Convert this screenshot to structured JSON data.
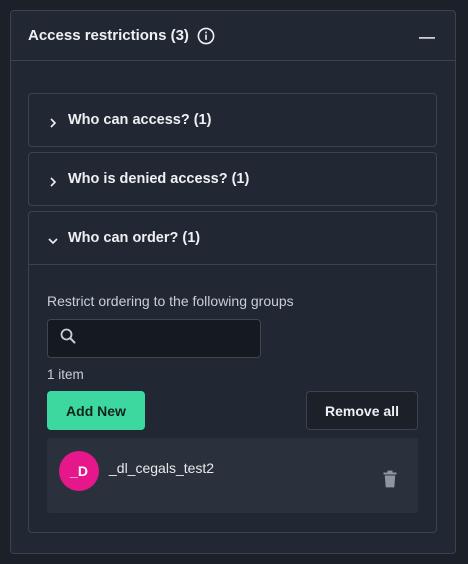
{
  "panel": {
    "title": "Access restrictions (3)",
    "accordions": [
      {
        "label": "Who can access? (1)",
        "expanded": false
      },
      {
        "label": "Who is denied access? (1)",
        "expanded": false
      },
      {
        "label": "Who can order? (1)",
        "expanded": true
      }
    ],
    "order": {
      "restrict_label": "Restrict ordering to the following groups",
      "search_value": "",
      "search_placeholder": "",
      "item_count": "1 item",
      "add_label": "Add New",
      "remove_all_label": "Remove all",
      "groups": [
        {
          "avatar": "_D",
          "name": "_dl_cegals_test2"
        }
      ]
    }
  },
  "colors": {
    "accent": "#3dd7a0",
    "avatar": "#e6168b",
    "background": "#1b2029",
    "panel": "#222833"
  },
  "icons": [
    "info-icon",
    "minus-icon",
    "chevron-right-icon",
    "chevron-down-icon",
    "search-icon",
    "trash-icon"
  ]
}
